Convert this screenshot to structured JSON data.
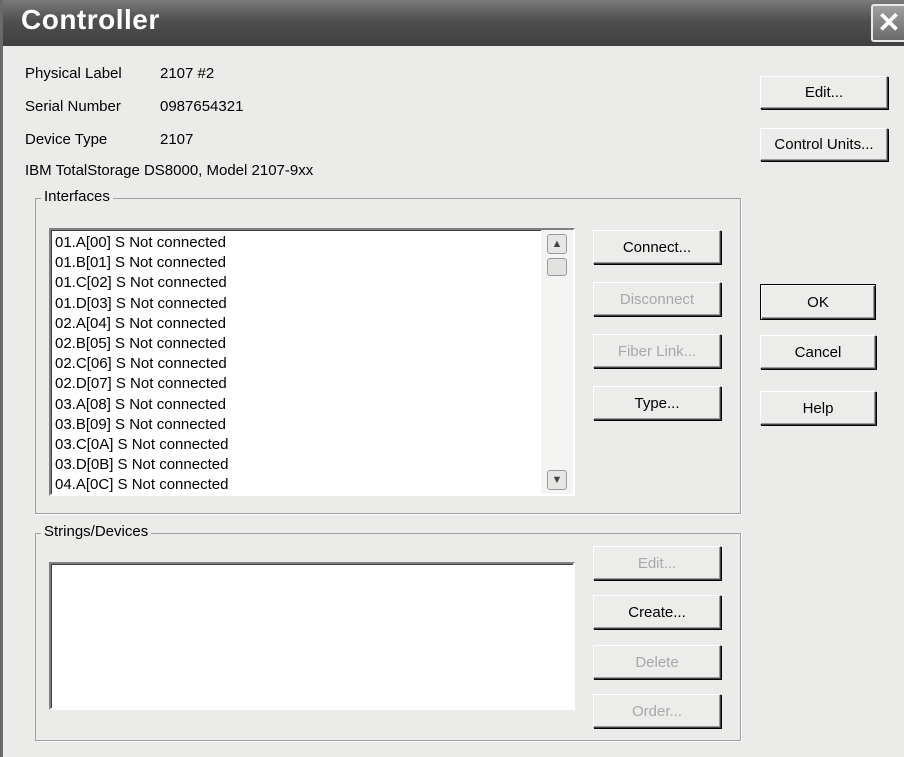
{
  "window": {
    "title": "Controller",
    "close_glyph": "✕"
  },
  "info": {
    "physical_label": {
      "label": "Physical Label",
      "value": "2107 #2"
    },
    "serial_number": {
      "label": "Serial Number",
      "value": "0987654321"
    },
    "device_type": {
      "label": "Device Type",
      "value": "2107"
    },
    "description": "IBM TotalStorage DS8000, Model 2107-9xx"
  },
  "buttons": {
    "edit": "Edit...",
    "control_units": "Control Units...",
    "ok": "OK",
    "cancel": "Cancel",
    "help": "Help"
  },
  "interfaces": {
    "legend": "Interfaces",
    "items": [
      "01.A[00] S Not connected",
      "01.B[01] S Not connected",
      "01.C[02] S Not connected",
      "01.D[03] S Not connected",
      "02.A[04] S Not connected",
      "02.B[05] S Not connected",
      "02.C[06] S Not connected",
      "02.D[07] S Not connected",
      "03.A[08] S Not connected",
      "03.B[09] S Not connected",
      "03.C[0A] S Not connected",
      "03.D[0B] S Not connected",
      "04.A[0C] S Not connected"
    ],
    "buttons": {
      "connect": "Connect...",
      "disconnect": "Disconnect",
      "fiber_link": "Fiber Link...",
      "type": "Type..."
    }
  },
  "strings_devices": {
    "legend": "Strings/Devices",
    "buttons": {
      "edit": "Edit...",
      "create": "Create...",
      "delete": "Delete",
      "order": "Order..."
    }
  },
  "icons": {
    "close": "close-icon",
    "scroll_up": "scroll-up-arrow-icon",
    "scroll_down": "scroll-down-arrow-icon"
  }
}
